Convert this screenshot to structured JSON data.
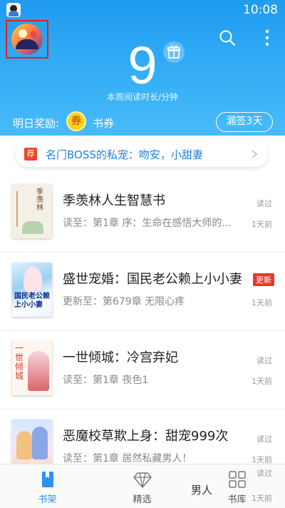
{
  "status_bar": {
    "time": "10:08"
  },
  "header": {
    "weekly_minutes": "9",
    "weekly_label": "本周阅读时长/分钟",
    "reward_label": "明日奖励:",
    "coin_glyph": "券",
    "coupon_label": "书券",
    "missed_button": "漏签3天",
    "accent_color": "#2a9cf2"
  },
  "notice": {
    "tag": "荐",
    "text": "名门BOSS的私宠：吻安，小甜妻"
  },
  "books": [
    {
      "title": "季羡林人生智慧书",
      "subtitle": "读至：第1章 序：生命在感悟大师的...",
      "status": "读过",
      "time": "1天前",
      "cover_text": "季羡林"
    },
    {
      "title": "盛世宠婚：国民老公赖上小小妻",
      "subtitle": "更新至：第679章 无限心疼",
      "status": "更新",
      "time": "1天前",
      "cover_text": "国民老公赖上小小妻"
    },
    {
      "title": "一世倾城：冷宫弃妃",
      "subtitle": "读至：第1章 夜色1",
      "status": "读过",
      "time": "1天前",
      "cover_text": "一世倾城"
    },
    {
      "title": "恶魔校草欺上身：甜宠999次",
      "subtitle": "读至：第1章 居然私藏男人！",
      "status": "读过",
      "time": "1天前"
    }
  ],
  "tabbar": {
    "tabs": [
      {
        "label": "书架",
        "icon": "bookshelf-icon",
        "active": true
      },
      {
        "label": "精选",
        "icon": "diamond-icon",
        "active": false
      },
      {
        "label": "书库",
        "icon": "grid-icon",
        "active": false
      }
    ],
    "overlay_text": "男人",
    "overlay_status": "读过",
    "overlay_time": "1天前"
  }
}
